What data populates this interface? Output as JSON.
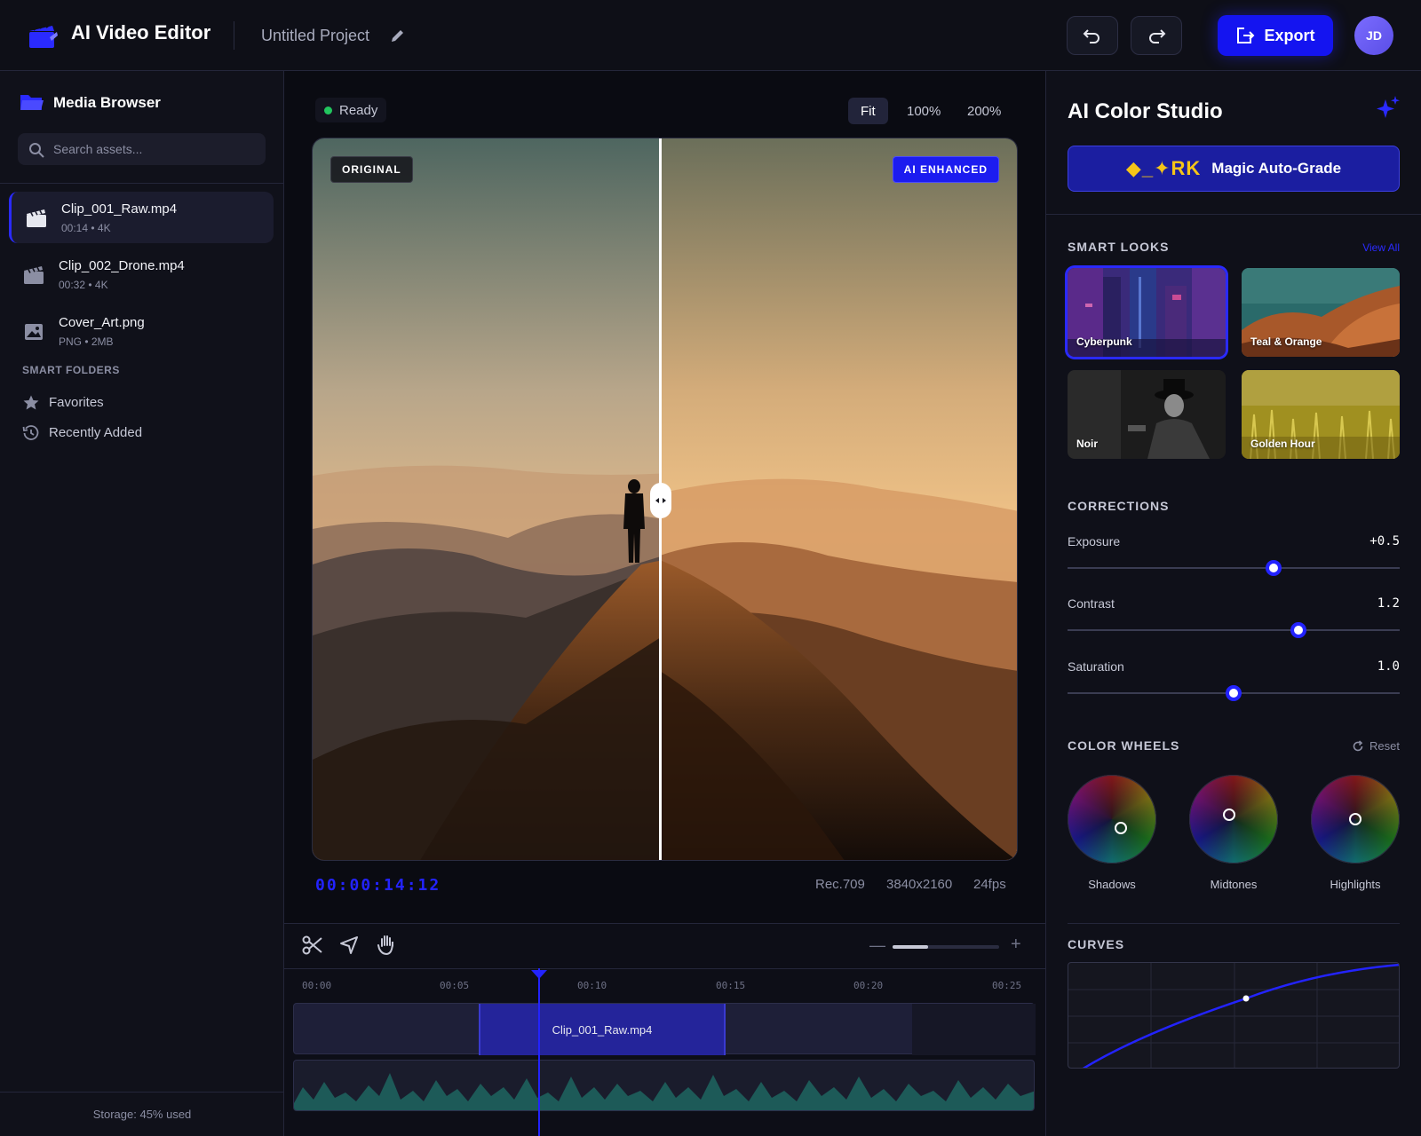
{
  "header": {
    "app_title": "AI Video Editor",
    "project_name": "Untitled Project",
    "export_label": "Export",
    "avatar_initials": "JD"
  },
  "media_browser": {
    "title": "Media Browser",
    "search_placeholder": "Search assets...",
    "assets": [
      {
        "name": "Clip_001_Raw.mp4",
        "meta": "00:14 • 4K",
        "type": "video",
        "active": true
      },
      {
        "name": "Clip_002_Drone.mp4",
        "meta": "00:32 • 4K",
        "type": "video",
        "active": false
      },
      {
        "name": "Cover_Art.png",
        "meta": "PNG • 2MB",
        "type": "image",
        "active": false
      }
    ],
    "smart_folders_heading": "SMART FOLDERS",
    "smart_folders": [
      {
        "label": "Favorites",
        "icon": "star-icon"
      },
      {
        "label": "Recently Added",
        "icon": "history-icon"
      }
    ],
    "storage": "Storage: 45% used"
  },
  "viewer": {
    "status": "Ready",
    "zoom_options": [
      "Fit",
      "100%",
      "200%"
    ],
    "zoom_selected": "Fit",
    "tag_original": "ORIGINAL",
    "tag_enhanced": "AI ENHANCED",
    "timecode": "00:00:14:12",
    "color_space": "Rec.709",
    "resolution": "3840x2160",
    "fps": "24fps"
  },
  "timeline": {
    "ruler": [
      "00:00",
      "00:05",
      "00:10",
      "00:15",
      "00:20",
      "00:25"
    ],
    "clip_name": "Clip_001_Raw.mp4",
    "zoom_level": 0.33
  },
  "color_studio": {
    "title": "AI Color Studio",
    "magic_glyphs": "◆_✦RK",
    "magic_label": "Magic Auto-Grade",
    "smart_looks_heading": "SMART LOOKS",
    "view_all": "View All",
    "looks": [
      {
        "name": "Cyberpunk",
        "active": true
      },
      {
        "name": "Teal & Orange",
        "active": false
      },
      {
        "name": "Noir",
        "active": false
      },
      {
        "name": "Golden Hour",
        "active": false
      }
    ],
    "corrections_heading": "CORRECTIONS",
    "corrections": [
      {
        "label": "Exposure",
        "value": "+0.5",
        "position": 0.62
      },
      {
        "label": "Contrast",
        "value": "1.2",
        "position": 0.695
      },
      {
        "label": "Saturation",
        "value": "1.0",
        "position": 0.5
      }
    ],
    "color_wheels_heading": "COLOR WHEELS",
    "reset_label": "Reset",
    "wheels": [
      {
        "label": "Shadows",
        "dot": [
          0.6,
          0.6
        ]
      },
      {
        "label": "Midtones",
        "dot": [
          0.45,
          0.45
        ]
      },
      {
        "label": "Highlights",
        "dot": [
          0.5,
          0.5
        ]
      }
    ],
    "curves_heading": "CURVES"
  },
  "colors": {
    "accent": "#2323ff",
    "ready": "#22c55e",
    "background": "#0d0e16"
  }
}
